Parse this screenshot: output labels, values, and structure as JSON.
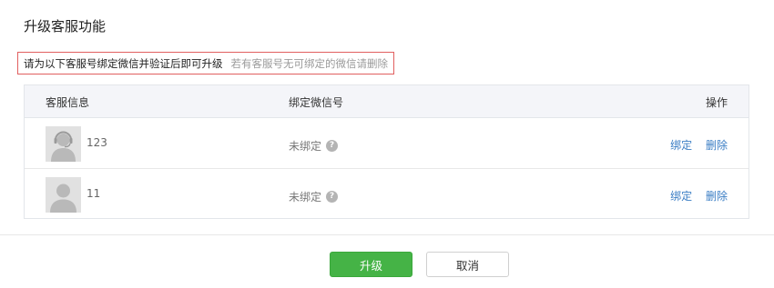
{
  "dialog": {
    "title": "升级客服功能"
  },
  "notice": {
    "main": "请为以下客服号绑定微信并验证后即可升级",
    "sub": "若有客服号无可绑定的微信请删除",
    "border_color": "#e15f5f"
  },
  "table": {
    "headers": {
      "info": "客服信息",
      "wechat": "绑定微信号",
      "actions": "操作"
    },
    "rows": [
      {
        "name": "123",
        "avatar_icon": "headset-agent-icon",
        "status": "未绑定",
        "help_icon": "?",
        "bind_label": "绑定",
        "delete_label": "删除"
      },
      {
        "name": "11",
        "avatar_icon": "user-silhouette-icon",
        "status": "未绑定",
        "help_icon": "?",
        "bind_label": "绑定",
        "delete_label": "删除"
      }
    ]
  },
  "footer": {
    "upgrade_label": "升级",
    "cancel_label": "取消",
    "primary_color": "#45b346"
  },
  "colors": {
    "link": "#3a7dc4",
    "header_bg": "#f4f5f9"
  }
}
